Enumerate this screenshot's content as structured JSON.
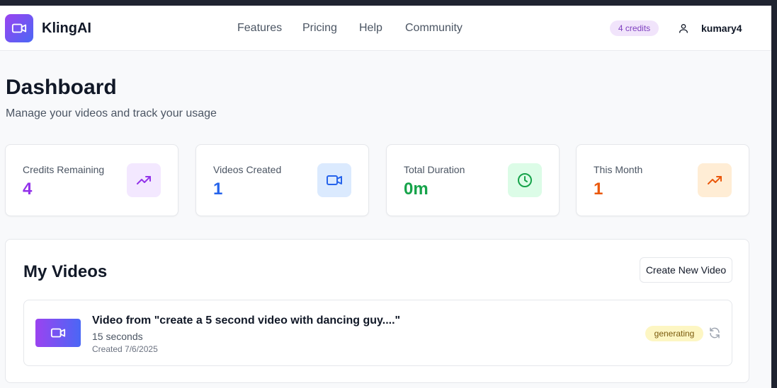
{
  "header": {
    "brand": "KlingAI",
    "nav": [
      {
        "label": "Features"
      },
      {
        "label": "Pricing"
      },
      {
        "label": "Help"
      },
      {
        "label": "Community"
      }
    ],
    "credits_badge": "4 credits",
    "username": "kumary4"
  },
  "page": {
    "title": "Dashboard",
    "subtitle": "Manage your videos and track your usage"
  },
  "stats": [
    {
      "label": "Credits Remaining",
      "value": "4",
      "color": "#9333ea",
      "icon": "trending-up-icon",
      "icon_bg": "#f3e8ff"
    },
    {
      "label": "Videos Created",
      "value": "1",
      "color": "#2563eb",
      "icon": "video-icon",
      "icon_bg": "#dbeafe"
    },
    {
      "label": "Total Duration",
      "value": "0m",
      "color": "#16a34a",
      "icon": "clock-icon",
      "icon_bg": "#dcfce7"
    },
    {
      "label": "This Month",
      "value": "1",
      "color": "#ea580c",
      "icon": "trending-up-icon",
      "icon_bg": "#ffedd5"
    }
  ],
  "videos": {
    "title": "My Videos",
    "create_label": "Create New Video",
    "items": [
      {
        "title": "Video from \"create a 5 second video with dancing guy....\"",
        "duration": "15 seconds",
        "created": "Created 7/6/2025",
        "status": "generating"
      }
    ]
  }
}
